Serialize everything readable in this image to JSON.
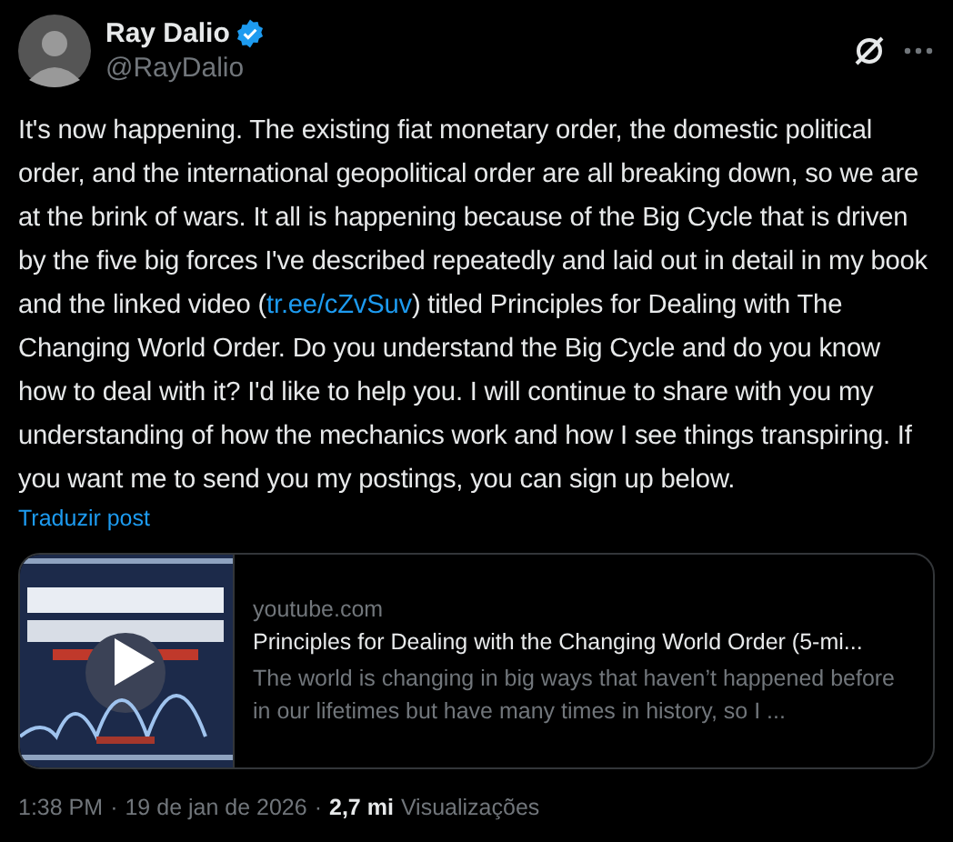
{
  "author": {
    "name": "Ray Dalio",
    "handle": "@RayDalio",
    "verified": true
  },
  "post": {
    "text_before": "It's now happening. The existing fiat monetary order, the domestic political order, and the international geopolitical order are all breaking down, so we are at the brink of wars. It all is happening because of the Big Cycle that is driven by the five big forces I've described repeatedly and laid out in detail in my book and the linked video (",
    "link": "tr.ee/cZvSuv",
    "text_after": ") titled Principles for Dealing with The Changing World Order. Do you understand the Big Cycle and do you know how to deal with it? I'd like to help you. I will continue to share with you my understanding of how the mechanics work and how I see things transpiring. If you want me to send you my postings, you can sign up below."
  },
  "translate": "Traduzir post",
  "link_card": {
    "domain": "youtube.com",
    "title": "Principles for Dealing with the Changing World Order (5-mi...",
    "description": "The world is changing in big ways that haven’t happened before in our lifetimes but have many times in history, so I ..."
  },
  "meta": {
    "time": "1:38 PM",
    "separator": "·",
    "date": "19 de jan de 2026",
    "separator_2": "·",
    "views": "2,7 mi",
    "views_label": "Visualizações"
  }
}
